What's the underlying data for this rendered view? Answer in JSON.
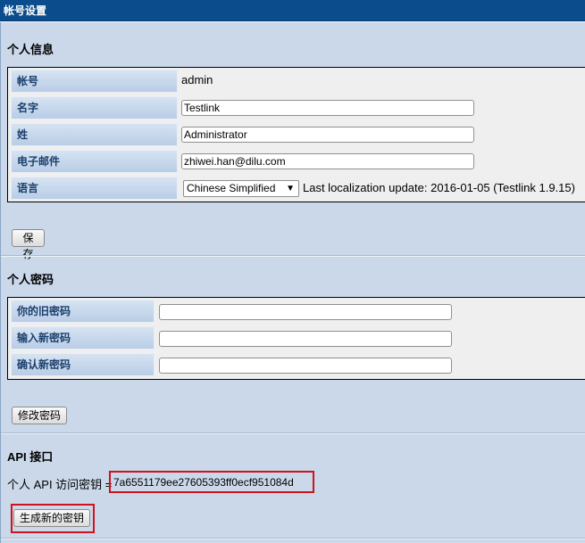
{
  "window": {
    "title": "帐号设置"
  },
  "personal_info": {
    "heading": "个人信息",
    "fields": [
      {
        "label": "帐号",
        "value": "admin"
      },
      {
        "label": "名字",
        "value": "Testlink"
      },
      {
        "label": "姓",
        "value": "Administrator"
      },
      {
        "label": "电子邮件",
        "value": "zhiwei.han@dilu.com"
      },
      {
        "label": "语言",
        "value": "Chinese Simplified"
      }
    ],
    "localization_note": "Last localization update: 2016-01-05 (Testlink 1.9.15)",
    "save_button": "保存"
  },
  "password": {
    "heading": "个人密码",
    "fields": [
      {
        "label": "你的旧密码",
        "value": ""
      },
      {
        "label": "输入新密码",
        "value": ""
      },
      {
        "label": "确认新密码",
        "value": ""
      }
    ],
    "change_button": "修改密码"
  },
  "api": {
    "heading": "API 接口",
    "key_label": "个人 API 访问密钥 =",
    "key_value": "7a6551179ee27605393ff0ecf951084d",
    "generate_button": "生成新的密钥"
  },
  "colors": {
    "titlebar": "#0b4d8c",
    "panel_background": "#cad8ea",
    "label_text": "#1b3f6e",
    "highlight": "#d0121a"
  }
}
